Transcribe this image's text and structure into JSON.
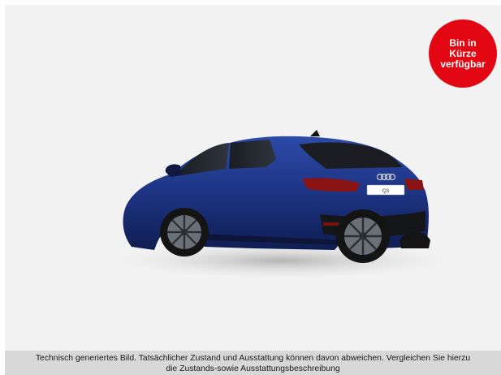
{
  "badge": {
    "line1": "Bin in",
    "line2": "Kürze",
    "line3": "verfügbar",
    "color": "#e30613"
  },
  "car": {
    "icon": "car-rear-three-quarter-image",
    "plate_text": "Q3",
    "body_color": "#1f3a8a"
  },
  "disclaimer": {
    "line1": "Technisch generiertes Bild. Tatsächlicher Zustand und Ausstattung können davon abweichen. Vergleichen Sie hierzu",
    "line2": "die Zustands-sowie Ausstattungsbeschreibung"
  }
}
